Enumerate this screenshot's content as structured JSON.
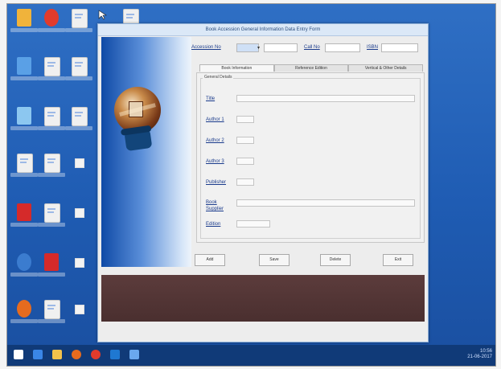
{
  "window": {
    "title": "Book Accession General Information Data Entry Form",
    "accession_label": "Accession No",
    "call_no_label": "Call No",
    "isbn_label": "ISBN"
  },
  "tabs": [
    {
      "label": "Book Information"
    },
    {
      "label": "Reference Edition"
    },
    {
      "label": "Vertical & Other Details"
    }
  ],
  "group": {
    "title": "General Details"
  },
  "fields": {
    "title": "Title",
    "author1": "Author 1",
    "author2": "Author 2",
    "author3": "Author 3",
    "publisher": "Publisher",
    "book_supplier": "Book Supplier",
    "edition": "Edition"
  },
  "buttons": {
    "add": "Add",
    "save": "Save",
    "delete": "Delete",
    "exit": "Exit"
  },
  "tray": {
    "time": "10:56",
    "date": "21-06-2017"
  }
}
